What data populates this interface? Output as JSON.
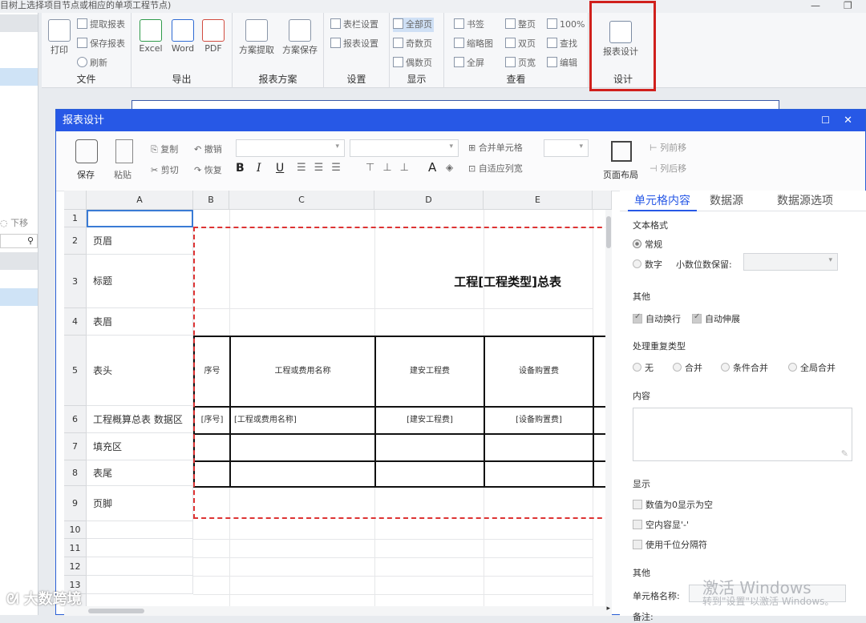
{
  "window": {
    "title": "目树上选择项目节点或相应的单项工程节点)",
    "minimize": "—",
    "restore": "❐"
  },
  "ribbon": {
    "file": {
      "label": "文件",
      "print": "打印",
      "fetch_report": "提取报表",
      "save_report": "保存报表",
      "refresh": "刷新"
    },
    "export": {
      "label": "导出",
      "excel": "Excel",
      "word": "Word",
      "pdf": "PDF"
    },
    "scheme": {
      "label": "报表方案",
      "fetch": "方案提取",
      "save": "方案保存"
    },
    "settings": {
      "label": "设置",
      "column_settings": "表栏设置",
      "report_settings": "报表设置"
    },
    "display": {
      "label": "显示",
      "all_pages": "全部页",
      "odd_pages": "奇数页",
      "even_pages": "偶数页"
    },
    "view": {
      "label": "查看",
      "bookmark": "书签",
      "thumbnail": "缩略图",
      "fullscreen": "全屏",
      "whole_page": "整页",
      "double_page": "双页",
      "page_width": "页宽",
      "zoom": "100%",
      "find": "查找",
      "edit": "编辑"
    },
    "design": {
      "label": "设计",
      "report_design": "报表设计"
    }
  },
  "left": {
    "move_down": "下移"
  },
  "dialog": {
    "title": "报表设计",
    "toolbar": {
      "save": "保存",
      "paste": "粘贴",
      "copy": "复制",
      "cut": "剪切",
      "undo": "撤销",
      "redo": "恢复",
      "bold": "B",
      "italic": "I",
      "underline": "U",
      "merge_cells": "合并单元格",
      "autofit_col": "自适应列宽",
      "page_layout": "页面布局",
      "col_forward": "列前移",
      "col_backward": "列后移",
      "font_color": "A"
    },
    "columns": [
      "A",
      "B",
      "C",
      "D",
      "E"
    ],
    "rows": [
      {
        "num": "1",
        "a": ""
      },
      {
        "num": "2",
        "a": "页眉"
      },
      {
        "num": "3",
        "a": "标题"
      },
      {
        "num": "4",
        "a": "表眉"
      },
      {
        "num": "5",
        "a": "表头"
      },
      {
        "num": "6",
        "a": "工程概算总表 数据区"
      },
      {
        "num": "7",
        "a": "填充区"
      },
      {
        "num": "8",
        "a": "表尾"
      },
      {
        "num": "9",
        "a": "页脚"
      },
      {
        "num": "10",
        "a": ""
      },
      {
        "num": "11",
        "a": ""
      },
      {
        "num": "12",
        "a": ""
      },
      {
        "num": "13",
        "a": ""
      }
    ],
    "report_title": "工程[工程类型]总表",
    "header": [
      "序号",
      "工程或费用名称",
      "建安工程费",
      "设备购置费"
    ],
    "data_row": [
      "[序号]",
      "[工程或费用名称]",
      "[建安工程费]",
      "[设备购置费]"
    ]
  },
  "panel": {
    "tabs": [
      "单元格内容",
      "数据源",
      "数据源选项"
    ],
    "text_format": "文本格式",
    "normal": "常规",
    "number": "数字",
    "decimals": "小数位数保留:",
    "other": "其他",
    "auto_wrap": "自动换行",
    "auto_extend": "自动伸展",
    "dup_type": "处理重复类型",
    "dup_options": [
      "无",
      "合并",
      "条件合并",
      "全局合并"
    ],
    "content": "内容",
    "display": "显示",
    "zero_empty": "数值为0显示为空",
    "empty_dash": "空内容显'-'",
    "thousands": "使用千位分隔符",
    "other2": "其他",
    "cell_name": "单元格名称:",
    "remark": "备注:"
  },
  "watermarks": {
    "activate": "激活 Windows",
    "activate_sub": "转到\"设置\"以激活 Windows。",
    "brand": "大数跨境"
  },
  "colors": {
    "accent": "#2758e6",
    "highlight": "#d0201c"
  }
}
